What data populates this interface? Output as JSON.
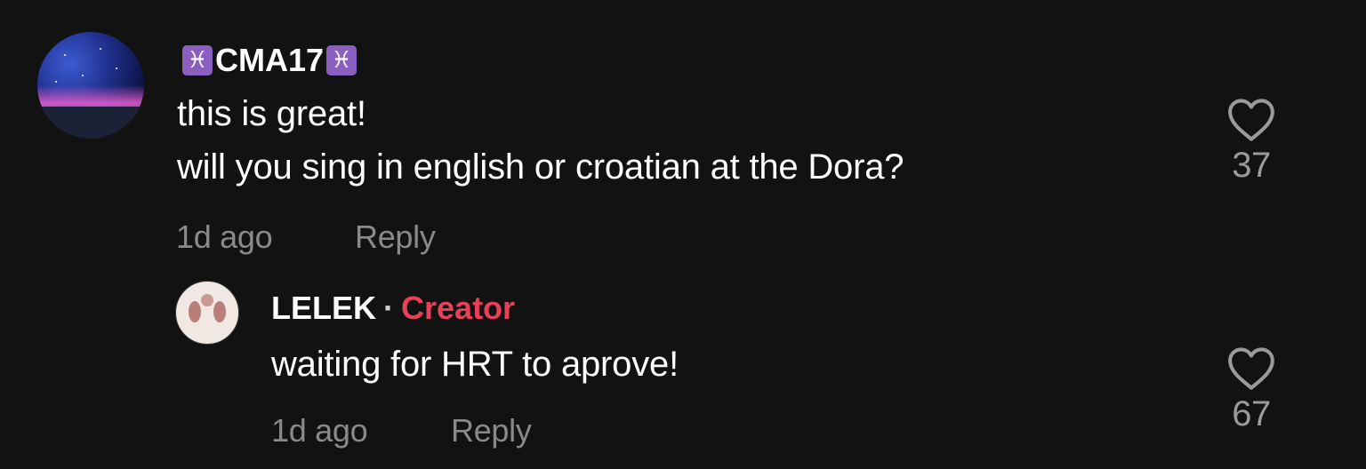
{
  "comments": [
    {
      "username": "CMA17",
      "badge_icon": "pisces-icon",
      "text_lines": [
        "this is great!",
        "will you sing in english or croatian at the Dora?"
      ],
      "time": "1d ago",
      "reply_label": "Reply",
      "likes": "37"
    }
  ],
  "reply": {
    "username": "LELEK",
    "separator": "·",
    "creator_label": "Creator",
    "text": "waiting for HRT to aprove!",
    "time": "1d ago",
    "reply_label": "Reply",
    "likes": "67"
  },
  "colors": {
    "background": "#121212",
    "creator": "#e9405a",
    "meta": "#8a8a8a",
    "badge": "#8a5fbf"
  }
}
